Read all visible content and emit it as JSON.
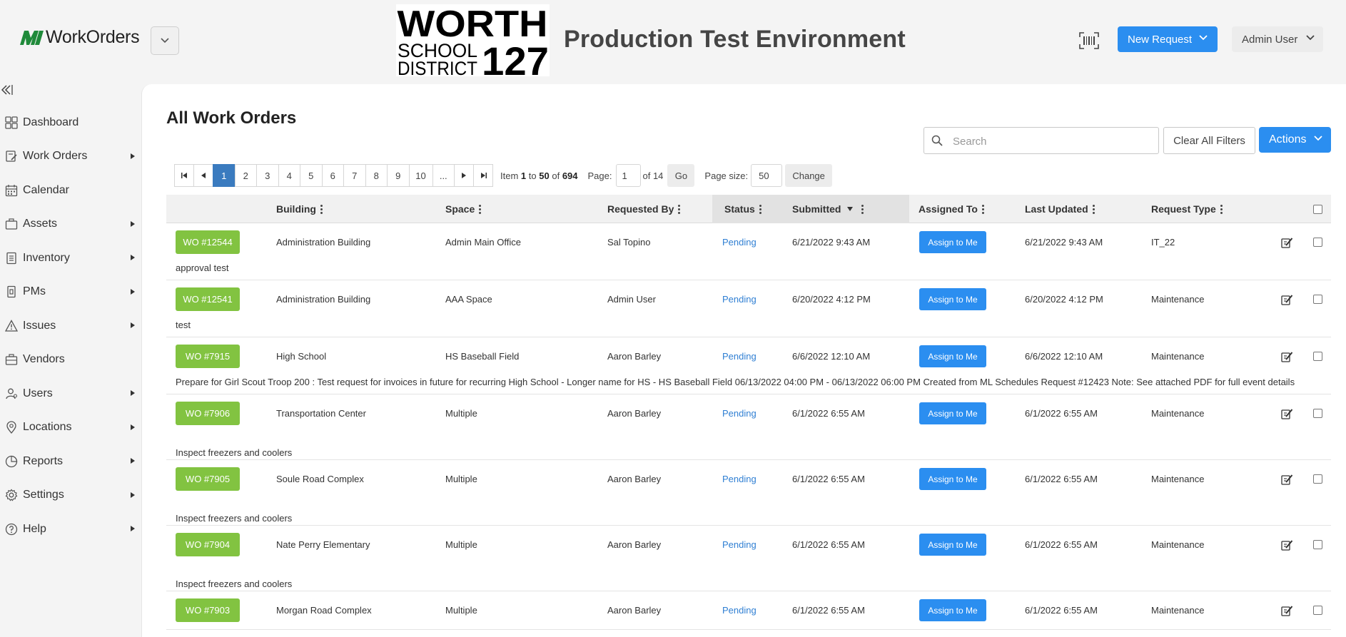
{
  "header": {
    "brand_name": "WorkOrders",
    "district_logo_text": [
      "WORTH",
      "SCHOOL",
      "DISTRICT",
      "127"
    ],
    "env_title": "Production Test Environment",
    "new_request_label": "New Request",
    "user_menu_label": "Admin User"
  },
  "sidebar": {
    "items": [
      {
        "label": "Dashboard",
        "icon": "dashboard-icon",
        "has_submenu": false
      },
      {
        "label": "Work Orders",
        "icon": "work-orders-icon",
        "has_submenu": true
      },
      {
        "label": "Calendar",
        "icon": "calendar-icon",
        "has_submenu": false
      },
      {
        "label": "Assets",
        "icon": "assets-icon",
        "has_submenu": true
      },
      {
        "label": "Inventory",
        "icon": "inventory-icon",
        "has_submenu": true
      },
      {
        "label": "PMs",
        "icon": "pms-icon",
        "has_submenu": true
      },
      {
        "label": "Issues",
        "icon": "issues-icon",
        "has_submenu": true
      },
      {
        "label": "Vendors",
        "icon": "vendors-icon",
        "has_submenu": false
      },
      {
        "label": "Users",
        "icon": "users-icon",
        "has_submenu": true
      },
      {
        "label": "Locations",
        "icon": "locations-icon",
        "has_submenu": true
      },
      {
        "label": "Reports",
        "icon": "reports-icon",
        "has_submenu": true
      },
      {
        "label": "Settings",
        "icon": "settings-icon",
        "has_submenu": true
      },
      {
        "label": "Help",
        "icon": "help-icon",
        "has_submenu": true
      }
    ]
  },
  "main": {
    "title": "All Work Orders",
    "search_placeholder": "Search",
    "clear_filters_label": "Clear All Filters",
    "actions_label": "Actions"
  },
  "pager": {
    "pages": [
      "1",
      "2",
      "3",
      "4",
      "5",
      "6",
      "7",
      "8",
      "9",
      "10",
      "..."
    ],
    "active_page": "1",
    "item_prefix": "Item",
    "item_from": "1",
    "item_to_word": "to",
    "item_to": "50",
    "item_of_word": "of",
    "item_total": "694",
    "page_label": "Page:",
    "page_value": "1",
    "of_pages": "of 14",
    "go_label": "Go",
    "page_size_label": "Page size:",
    "page_size_value": "50",
    "change_label": "Change"
  },
  "table": {
    "columns": {
      "building": "Building",
      "space": "Space",
      "requested_by": "Requested By",
      "status": "Status",
      "submitted": "Submitted",
      "assigned_to": "Assigned To",
      "last_updated": "Last Updated",
      "request_type": "Request Type"
    },
    "assign_label": "Assign to Me",
    "rows": [
      {
        "wo": "WO #12544",
        "building": "Administration Building",
        "space": "Admin Main Office",
        "requested_by": "Sal Topino",
        "status": "Pending",
        "submitted": "6/21/2022 9:43 AM",
        "last_updated": "6/21/2022 9:43 AM",
        "request_type": "IT_22",
        "description": "approval test"
      },
      {
        "wo": "WO #12541",
        "building": "Administration Building",
        "space": "AAA Space",
        "requested_by": "Admin User",
        "status": "Pending",
        "submitted": "6/20/2022 4:12 PM",
        "last_updated": "6/20/2022 4:12 PM",
        "request_type": "Maintenance",
        "description": "test"
      },
      {
        "wo": "WO #7915",
        "building": "High School",
        "space": "HS Baseball Field",
        "requested_by": "Aaron Barley",
        "status": "Pending",
        "submitted": "6/6/2022 12:10 AM",
        "last_updated": "6/6/2022 12:10 AM",
        "request_type": "Maintenance",
        "description": "Prepare for Girl Scout Troop 200 : Test request for invoices in future for recurring High School - Longer name for HS - HS Baseball Field 06/13/2022 04:00 PM - 06/13/2022 06:00 PM Created from ML Schedules Request #12423 Note: See attached PDF for full event details"
      },
      {
        "wo": "WO #7906",
        "building": "Transportation Center",
        "space": "Multiple",
        "requested_by": "Aaron Barley",
        "status": "Pending",
        "submitted": "6/1/2022 6:55 AM",
        "last_updated": "6/1/2022 6:55 AM",
        "request_type": "Maintenance",
        "description": "Inspect freezers and coolers"
      },
      {
        "wo": "WO #7905",
        "building": "Soule Road Complex",
        "space": "Multiple",
        "requested_by": "Aaron Barley",
        "status": "Pending",
        "submitted": "6/1/2022 6:55 AM",
        "last_updated": "6/1/2022 6:55 AM",
        "request_type": "Maintenance",
        "description": "Inspect freezers and coolers"
      },
      {
        "wo": "WO #7904",
        "building": "Nate Perry Elementary",
        "space": "Multiple",
        "requested_by": "Aaron Barley",
        "status": "Pending",
        "submitted": "6/1/2022 6:55 AM",
        "last_updated": "6/1/2022 6:55 AM",
        "request_type": "Maintenance",
        "description": "Inspect freezers and coolers"
      },
      {
        "wo": "WO #7903",
        "building": "Morgan Road Complex",
        "space": "Multiple",
        "requested_by": "Aaron Barley",
        "status": "Pending",
        "submitted": "6/1/2022 6:55 AM",
        "last_updated": "6/1/2022 6:55 AM",
        "request_type": "Maintenance",
        "description": ""
      }
    ]
  },
  "colors": {
    "accent_blue": "#2b8ef0",
    "wo_green": "#82c341",
    "status_blue": "#2f7fd3",
    "brand_green": "#1f8a3a"
  }
}
